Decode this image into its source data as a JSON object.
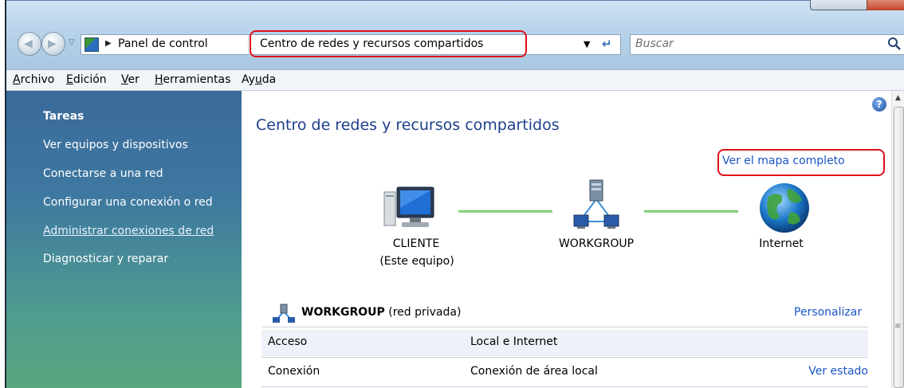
{
  "address": {
    "breadcrumb_root": "Panel de control",
    "current": "Centro de redes y recursos compartidos",
    "search_placeholder": "Buscar"
  },
  "menu": {
    "archivo": "Archivo",
    "edicion": "Edición",
    "ver": "Ver",
    "herramientas": "Herramientas",
    "ayuda": "Ayuda"
  },
  "sidebar": {
    "title": "Tareas",
    "items": [
      {
        "label": "Ver equipos y dispositivos"
      },
      {
        "label": "Conectarse a una red"
      },
      {
        "label": "Configurar una conexión o red"
      },
      {
        "label": "Administrar conexiones de red"
      },
      {
        "label": "Diagnosticar y reparar"
      }
    ]
  },
  "main": {
    "title": "Centro de redes y recursos compartidos",
    "map_link": "Ver el mapa completo",
    "nodes": [
      {
        "name": "CLIENTE",
        "sub": "(Este equipo)"
      },
      {
        "name": "WORKGROUP"
      },
      {
        "name": "Internet"
      }
    ],
    "network": {
      "name": "WORKGROUP",
      "type": "(red privada)",
      "customize": "Personalizar",
      "rows": [
        {
          "key": "Acceso",
          "value": "Local e Internet"
        },
        {
          "key": "Conexión",
          "value": "Conexión de área local",
          "link": "Ver estado"
        }
      ]
    }
  },
  "colors": {
    "link": "#1a55c7",
    "title": "#1e3f8c",
    "highlight": "#e0111a"
  }
}
